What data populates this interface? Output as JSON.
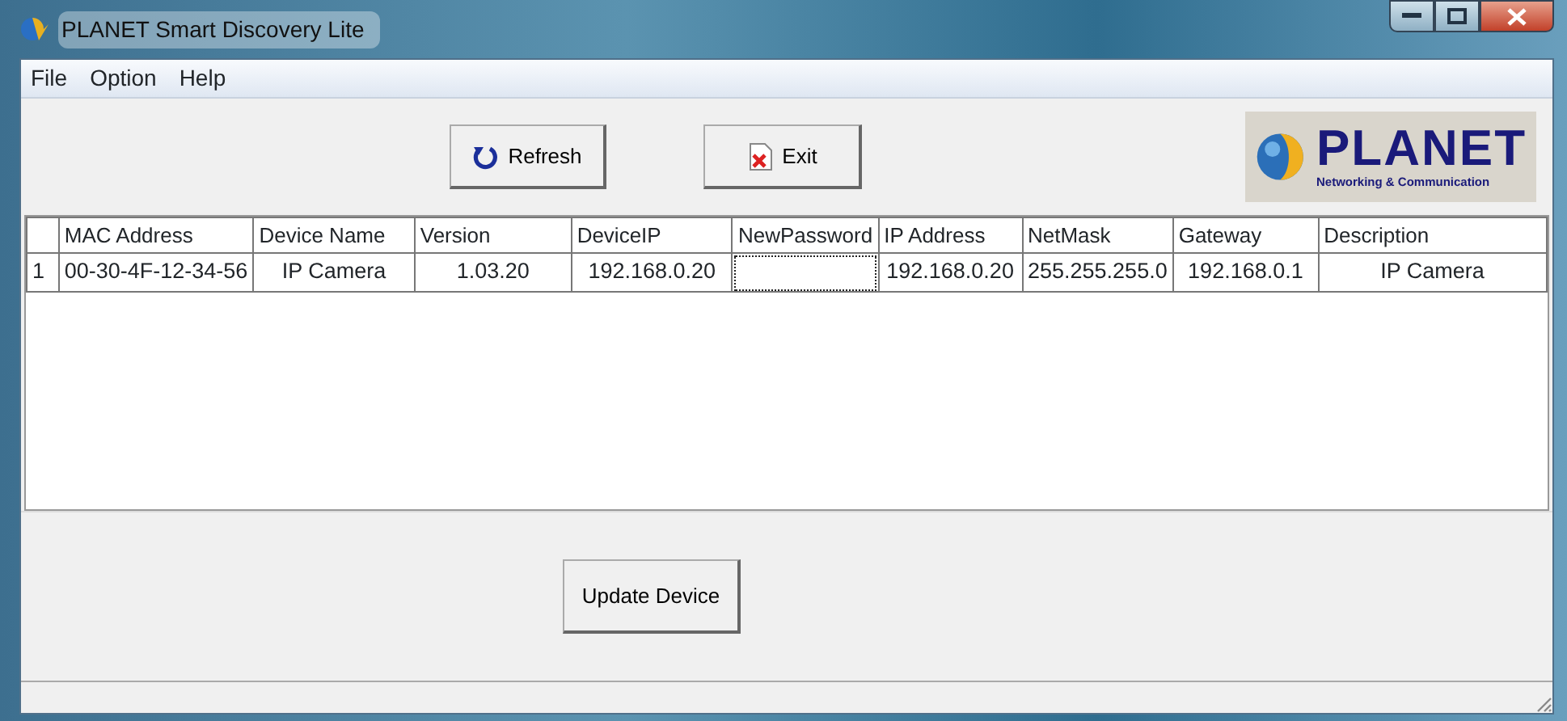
{
  "window": {
    "title": "PLANET Smart Discovery Lite"
  },
  "menu": [
    "File",
    "Option",
    "Help"
  ],
  "toolbar": {
    "buttons": [
      {
        "label": "Refresh",
        "kind": "refresh"
      },
      {
        "label": "Exit",
        "kind": "exit"
      }
    ],
    "logo": {
      "name": "PLANET",
      "tagline": "Networking & Communication"
    }
  },
  "table": {
    "columns": [
      "MAC Address",
      "Device Name",
      "Version",
      "DeviceIP",
      "NewPassword",
      "IP Address",
      "NetMask",
      "Gateway",
      "Description"
    ],
    "rows": [
      {
        "number": "1",
        "cells": [
          {
            "kind": "text",
            "text": "00-30-4F-12-34-56"
          },
          {
            "kind": "text",
            "text": "IP Camera"
          },
          {
            "kind": "text",
            "text": "1.03.20"
          },
          {
            "kind": "text",
            "text": "192.168.0.20"
          },
          {
            "kind": "input",
            "focused": true
          },
          {
            "kind": "text",
            "text": "192.168.0.20"
          },
          {
            "kind": "text",
            "text": "255.255.255.0"
          },
          {
            "kind": "text",
            "text": "192.168.0.1"
          },
          {
            "kind": "text",
            "text": "IP Camera"
          }
        ]
      }
    ]
  },
  "update_button": "Update Device"
}
